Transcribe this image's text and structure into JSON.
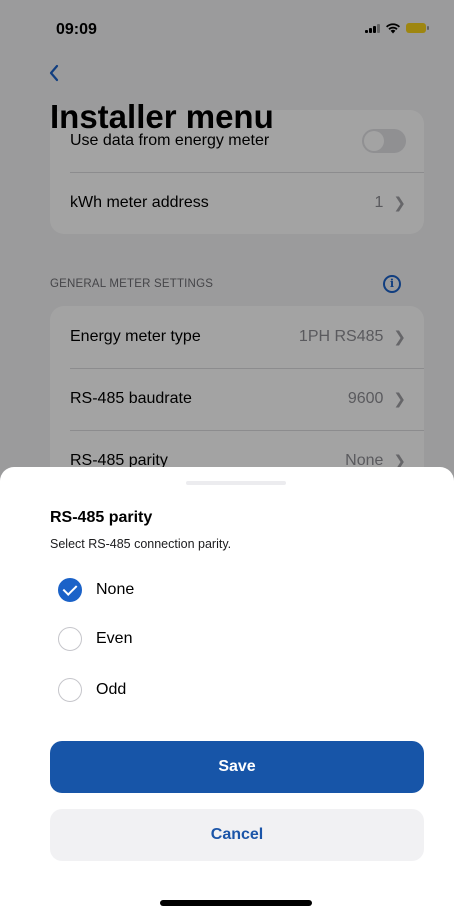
{
  "status_bar": {
    "time": "09:09"
  },
  "header": {
    "back_icon": "chevron-left-icon",
    "title": "Installer menu"
  },
  "energy_card": {
    "items": [
      {
        "label": "Use data from energy meter",
        "toggle_on": false
      },
      {
        "label": "kWh meter address",
        "value": "1"
      }
    ]
  },
  "general_meter_settings": {
    "header": "GENERAL METER SETTINGS",
    "info_icon": "info-icon",
    "items": [
      {
        "label": "Energy meter type",
        "value": "1PH RS485"
      },
      {
        "label": "RS-485 baudrate",
        "value": "9600"
      },
      {
        "label": "RS-485 parity",
        "value": "None"
      }
    ]
  },
  "sheet": {
    "title": "RS-485 parity",
    "description": "Select RS-485 connection parity.",
    "options": [
      {
        "label": "None",
        "selected": true
      },
      {
        "label": "Even",
        "selected": false
      },
      {
        "label": "Odd",
        "selected": false
      }
    ],
    "save_label": "Save",
    "cancel_label": "Cancel"
  },
  "colors": {
    "accent": "#1b62c8",
    "save_button": "#1755a8",
    "battery": "#f7d21a"
  }
}
